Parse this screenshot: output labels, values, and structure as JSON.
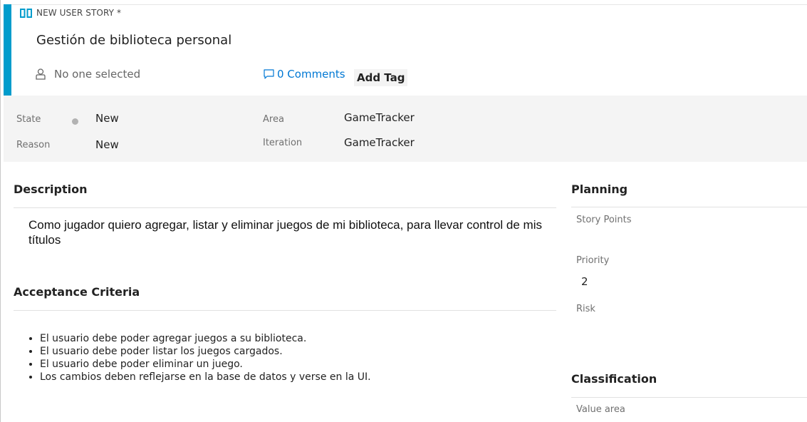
{
  "header": {
    "type_label": "NEW USER STORY *",
    "title": "Gestión de biblioteca personal",
    "assigned_to": "No one selected",
    "comments_label": "0 Comments",
    "add_tag_label": "Add Tag",
    "accent_color": "#009ccc",
    "link_color": "#0078d4"
  },
  "fields": {
    "state_label": "State",
    "state_value": "New",
    "reason_label": "Reason",
    "reason_value": "New",
    "area_label": "Area",
    "area_value": "GameTracker",
    "iteration_label": "Iteration",
    "iteration_value": "GameTracker"
  },
  "description": {
    "title": "Description",
    "text": "Como jugador quiero agregar, listar y eliminar juegos de mi biblioteca, para llevar control de mis títulos"
  },
  "acceptance": {
    "title": "Acceptance Criteria",
    "items": [
      "El usuario debe poder agregar juegos a su biblioteca.",
      "El usuario debe poder listar los juegos cargados.",
      "El usuario debe poder eliminar un juego.",
      "Los cambios deben reflejarse en la base de datos y verse en la UI."
    ]
  },
  "planning": {
    "title": "Planning",
    "story_points_label": "Story Points",
    "priority_label": "Priority",
    "priority_value": "2",
    "risk_label": "Risk"
  },
  "classification": {
    "title": "Classification",
    "value_area_label": "Value area"
  },
  "icons": {
    "type": "book-icon",
    "assigned": "person-icon",
    "comments": "comment-icon",
    "state": "state-dot"
  }
}
